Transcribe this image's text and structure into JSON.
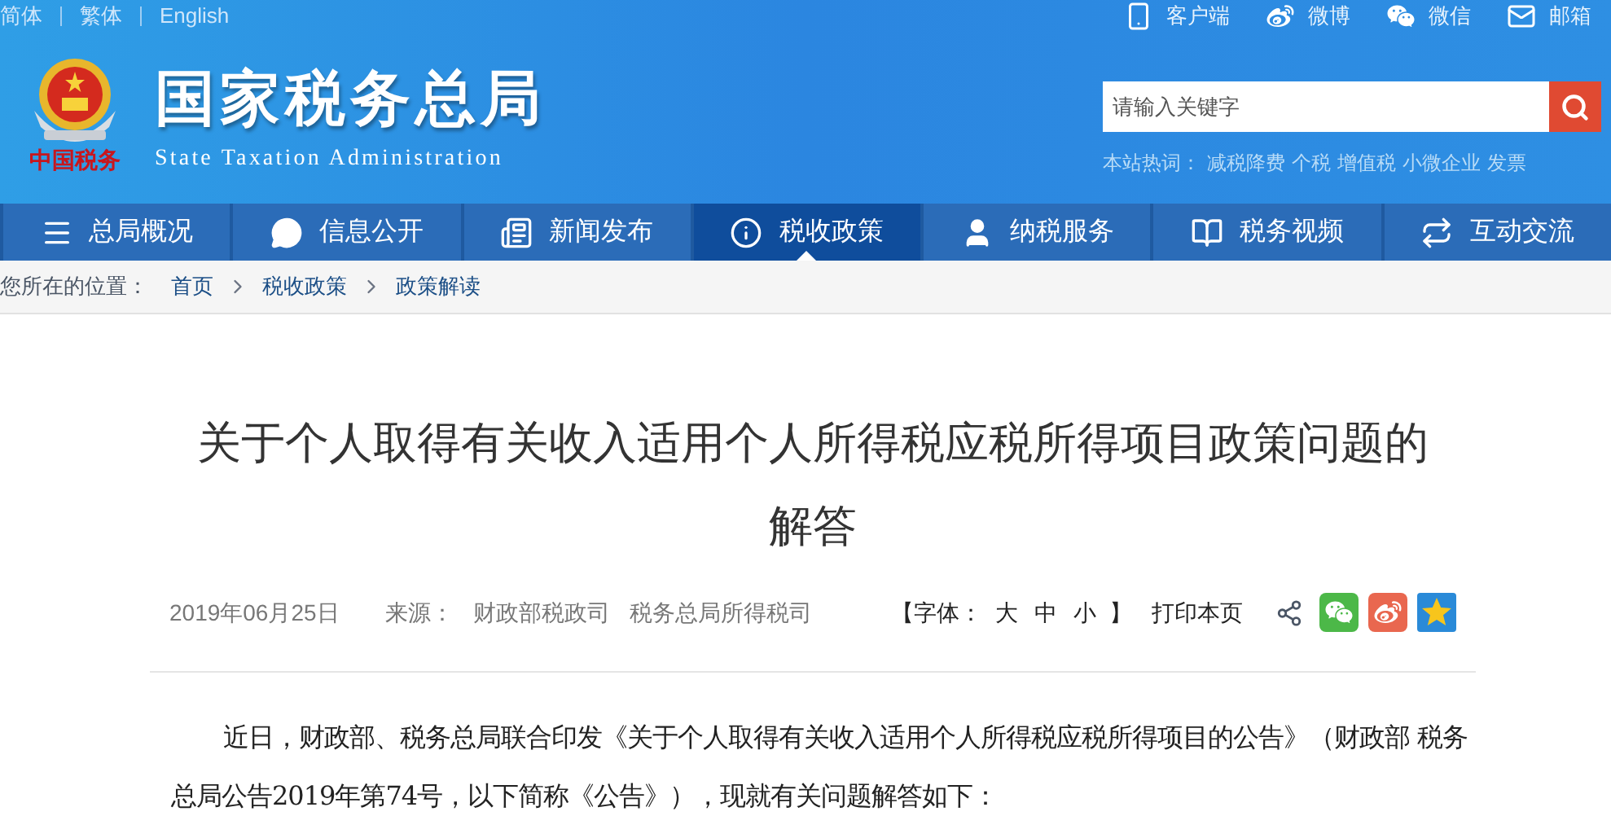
{
  "top_links": [
    {
      "label": "简体"
    },
    {
      "label": "繁体"
    },
    {
      "label": "English"
    }
  ],
  "header": {
    "title": "国家税务总局",
    "subtitle": "State Taxation Administration",
    "logo_caption": "中国税务"
  },
  "quick_links": [
    {
      "kind": "phone",
      "label": "客户端"
    },
    {
      "kind": "weibo",
      "label": "微博"
    },
    {
      "kind": "wechat",
      "label": "微信"
    },
    {
      "kind": "mail",
      "label": "邮箱"
    }
  ],
  "search": {
    "placeholder": "请输入关键字"
  },
  "hot_words": {
    "label": "本站热词：",
    "items": [
      "减税降费",
      "个税",
      "增值税",
      "小微企业",
      "发票"
    ]
  },
  "nav": [
    {
      "kind": "menu",
      "label": "总局概况",
      "selected": false
    },
    {
      "kind": "chat",
      "label": "信息公开",
      "selected": false
    },
    {
      "kind": "news",
      "label": "新闻发布",
      "selected": false
    },
    {
      "kind": "info",
      "label": "税收政策",
      "selected": true
    },
    {
      "kind": "user",
      "label": "纳税服务",
      "selected": false
    },
    {
      "kind": "video",
      "label": "税务视频",
      "selected": false
    },
    {
      "kind": "exchange",
      "label": "互动交流",
      "selected": false
    }
  ],
  "breadcrumb": {
    "label": "您所在的位置：",
    "items": [
      "首页",
      "税收政策",
      "政策解读"
    ]
  },
  "article": {
    "title": "关于个人取得有关收入适用个人所得税应税所得项目政策问题的解答",
    "date": "2019年06月25日",
    "source_label": "来源：",
    "sources": [
      "财政部税政司",
      "税务总局所得税司"
    ],
    "font_size": {
      "label": "【字体：",
      "options": [
        "大",
        "中",
        "小"
      ],
      "end": "】"
    },
    "print": "打印本页",
    "share": [
      {
        "kind": "share"
      },
      {
        "kind": "wechat"
      },
      {
        "kind": "weibo"
      },
      {
        "kind": "qzone"
      }
    ],
    "paragraph": "近日，财政部、税务总局联合印发《关于个人取得有关收入适用个人所得税应税所得项目的公告》（财政部 税务总局公告2019年第74号，以下简称《公告》），现就有关问题解答如下："
  }
}
